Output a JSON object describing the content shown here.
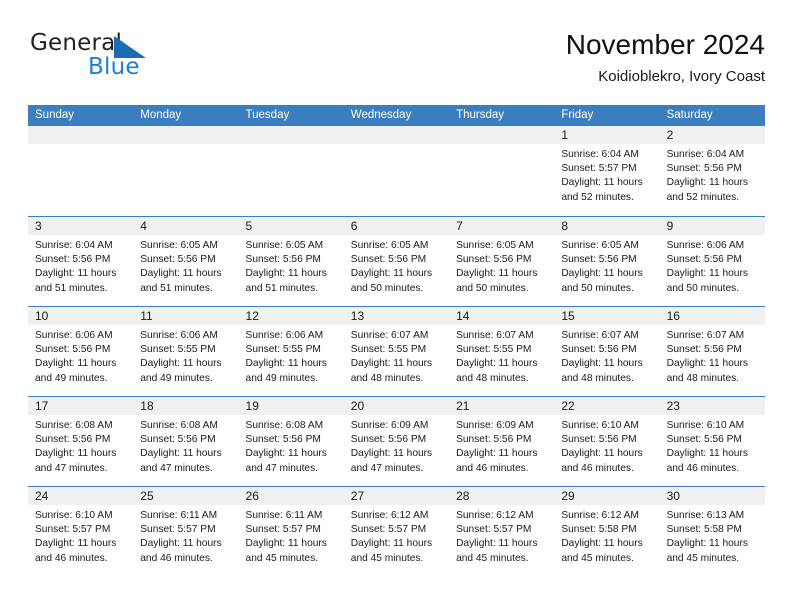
{
  "brand": {
    "name_top": "General",
    "name_bottom": "Blue",
    "accent_color": "#1b7fd4",
    "triangle_color": "#1b6cb5"
  },
  "header": {
    "title": "November 2024",
    "subtitle": "Koidioblekro, Ivory Coast"
  },
  "theme": {
    "header_blue": "#3a7ebf",
    "day_band_gray": "#f0f0f0",
    "text_color": "#1a1a1a"
  },
  "weekdays": [
    "Sunday",
    "Monday",
    "Tuesday",
    "Wednesday",
    "Thursday",
    "Friday",
    "Saturday"
  ],
  "weeks": [
    [
      {
        "day": "",
        "sunrise": "",
        "sunset": "",
        "daylight_1": "",
        "daylight_2": ""
      },
      {
        "day": "",
        "sunrise": "",
        "sunset": "",
        "daylight_1": "",
        "daylight_2": ""
      },
      {
        "day": "",
        "sunrise": "",
        "sunset": "",
        "daylight_1": "",
        "daylight_2": ""
      },
      {
        "day": "",
        "sunrise": "",
        "sunset": "",
        "daylight_1": "",
        "daylight_2": ""
      },
      {
        "day": "",
        "sunrise": "",
        "sunset": "",
        "daylight_1": "",
        "daylight_2": ""
      },
      {
        "day": "1",
        "sunrise": "Sunrise: 6:04 AM",
        "sunset": "Sunset: 5:57 PM",
        "daylight_1": "Daylight: 11 hours",
        "daylight_2": "and 52 minutes."
      },
      {
        "day": "2",
        "sunrise": "Sunrise: 6:04 AM",
        "sunset": "Sunset: 5:56 PM",
        "daylight_1": "Daylight: 11 hours",
        "daylight_2": "and 52 minutes."
      }
    ],
    [
      {
        "day": "3",
        "sunrise": "Sunrise: 6:04 AM",
        "sunset": "Sunset: 5:56 PM",
        "daylight_1": "Daylight: 11 hours",
        "daylight_2": "and 51 minutes."
      },
      {
        "day": "4",
        "sunrise": "Sunrise: 6:05 AM",
        "sunset": "Sunset: 5:56 PM",
        "daylight_1": "Daylight: 11 hours",
        "daylight_2": "and 51 minutes."
      },
      {
        "day": "5",
        "sunrise": "Sunrise: 6:05 AM",
        "sunset": "Sunset: 5:56 PM",
        "daylight_1": "Daylight: 11 hours",
        "daylight_2": "and 51 minutes."
      },
      {
        "day": "6",
        "sunrise": "Sunrise: 6:05 AM",
        "sunset": "Sunset: 5:56 PM",
        "daylight_1": "Daylight: 11 hours",
        "daylight_2": "and 50 minutes."
      },
      {
        "day": "7",
        "sunrise": "Sunrise: 6:05 AM",
        "sunset": "Sunset: 5:56 PM",
        "daylight_1": "Daylight: 11 hours",
        "daylight_2": "and 50 minutes."
      },
      {
        "day": "8",
        "sunrise": "Sunrise: 6:05 AM",
        "sunset": "Sunset: 5:56 PM",
        "daylight_1": "Daylight: 11 hours",
        "daylight_2": "and 50 minutes."
      },
      {
        "day": "9",
        "sunrise": "Sunrise: 6:06 AM",
        "sunset": "Sunset: 5:56 PM",
        "daylight_1": "Daylight: 11 hours",
        "daylight_2": "and 50 minutes."
      }
    ],
    [
      {
        "day": "10",
        "sunrise": "Sunrise: 6:06 AM",
        "sunset": "Sunset: 5:56 PM",
        "daylight_1": "Daylight: 11 hours",
        "daylight_2": "and 49 minutes."
      },
      {
        "day": "11",
        "sunrise": "Sunrise: 6:06 AM",
        "sunset": "Sunset: 5:55 PM",
        "daylight_1": "Daylight: 11 hours",
        "daylight_2": "and 49 minutes."
      },
      {
        "day": "12",
        "sunrise": "Sunrise: 6:06 AM",
        "sunset": "Sunset: 5:55 PM",
        "daylight_1": "Daylight: 11 hours",
        "daylight_2": "and 49 minutes."
      },
      {
        "day": "13",
        "sunrise": "Sunrise: 6:07 AM",
        "sunset": "Sunset: 5:55 PM",
        "daylight_1": "Daylight: 11 hours",
        "daylight_2": "and 48 minutes."
      },
      {
        "day": "14",
        "sunrise": "Sunrise: 6:07 AM",
        "sunset": "Sunset: 5:55 PM",
        "daylight_1": "Daylight: 11 hours",
        "daylight_2": "and 48 minutes."
      },
      {
        "day": "15",
        "sunrise": "Sunrise: 6:07 AM",
        "sunset": "Sunset: 5:56 PM",
        "daylight_1": "Daylight: 11 hours",
        "daylight_2": "and 48 minutes."
      },
      {
        "day": "16",
        "sunrise": "Sunrise: 6:07 AM",
        "sunset": "Sunset: 5:56 PM",
        "daylight_1": "Daylight: 11 hours",
        "daylight_2": "and 48 minutes."
      }
    ],
    [
      {
        "day": "17",
        "sunrise": "Sunrise: 6:08 AM",
        "sunset": "Sunset: 5:56 PM",
        "daylight_1": "Daylight: 11 hours",
        "daylight_2": "and 47 minutes."
      },
      {
        "day": "18",
        "sunrise": "Sunrise: 6:08 AM",
        "sunset": "Sunset: 5:56 PM",
        "daylight_1": "Daylight: 11 hours",
        "daylight_2": "and 47 minutes."
      },
      {
        "day": "19",
        "sunrise": "Sunrise: 6:08 AM",
        "sunset": "Sunset: 5:56 PM",
        "daylight_1": "Daylight: 11 hours",
        "daylight_2": "and 47 minutes."
      },
      {
        "day": "20",
        "sunrise": "Sunrise: 6:09 AM",
        "sunset": "Sunset: 5:56 PM",
        "daylight_1": "Daylight: 11 hours",
        "daylight_2": "and 47 minutes."
      },
      {
        "day": "21",
        "sunrise": "Sunrise: 6:09 AM",
        "sunset": "Sunset: 5:56 PM",
        "daylight_1": "Daylight: 11 hours",
        "daylight_2": "and 46 minutes."
      },
      {
        "day": "22",
        "sunrise": "Sunrise: 6:10 AM",
        "sunset": "Sunset: 5:56 PM",
        "daylight_1": "Daylight: 11 hours",
        "daylight_2": "and 46 minutes."
      },
      {
        "day": "23",
        "sunrise": "Sunrise: 6:10 AM",
        "sunset": "Sunset: 5:56 PM",
        "daylight_1": "Daylight: 11 hours",
        "daylight_2": "and 46 minutes."
      }
    ],
    [
      {
        "day": "24",
        "sunrise": "Sunrise: 6:10 AM",
        "sunset": "Sunset: 5:57 PM",
        "daylight_1": "Daylight: 11 hours",
        "daylight_2": "and 46 minutes."
      },
      {
        "day": "25",
        "sunrise": "Sunrise: 6:11 AM",
        "sunset": "Sunset: 5:57 PM",
        "daylight_1": "Daylight: 11 hours",
        "daylight_2": "and 46 minutes."
      },
      {
        "day": "26",
        "sunrise": "Sunrise: 6:11 AM",
        "sunset": "Sunset: 5:57 PM",
        "daylight_1": "Daylight: 11 hours",
        "daylight_2": "and 45 minutes."
      },
      {
        "day": "27",
        "sunrise": "Sunrise: 6:12 AM",
        "sunset": "Sunset: 5:57 PM",
        "daylight_1": "Daylight: 11 hours",
        "daylight_2": "and 45 minutes."
      },
      {
        "day": "28",
        "sunrise": "Sunrise: 6:12 AM",
        "sunset": "Sunset: 5:57 PM",
        "daylight_1": "Daylight: 11 hours",
        "daylight_2": "and 45 minutes."
      },
      {
        "day": "29",
        "sunrise": "Sunrise: 6:12 AM",
        "sunset": "Sunset: 5:58 PM",
        "daylight_1": "Daylight: 11 hours",
        "daylight_2": "and 45 minutes."
      },
      {
        "day": "30",
        "sunrise": "Sunrise: 6:13 AM",
        "sunset": "Sunset: 5:58 PM",
        "daylight_1": "Daylight: 11 hours",
        "daylight_2": "and 45 minutes."
      }
    ]
  ]
}
